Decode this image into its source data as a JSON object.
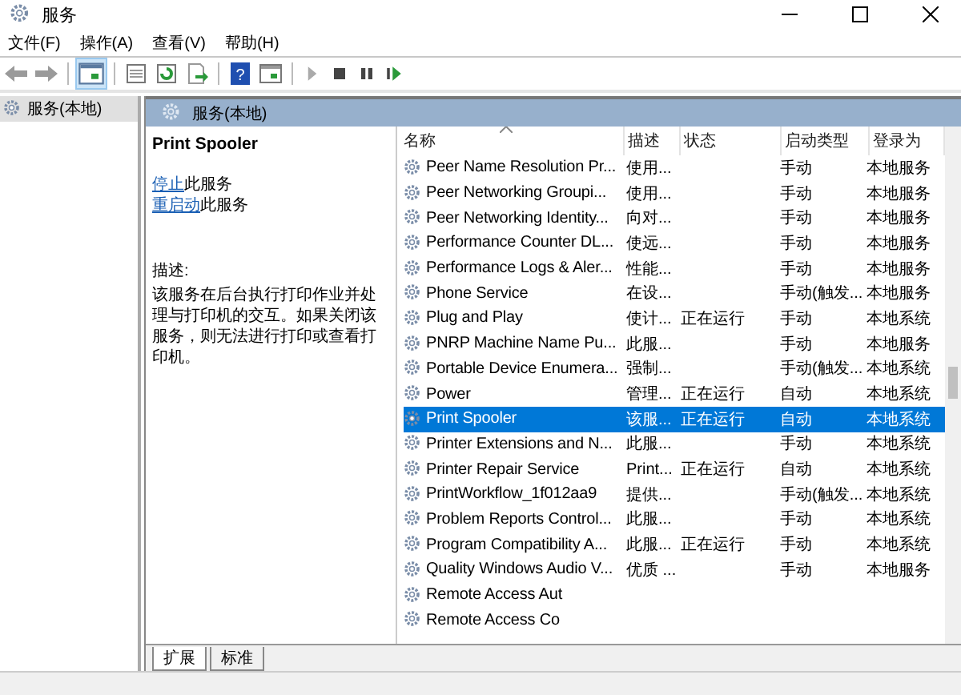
{
  "window": {
    "title": "服务"
  },
  "menu": [
    "文件(F)",
    "操作(A)",
    "查看(V)",
    "帮助(H)"
  ],
  "toolbar": {
    "help_glyph": "?"
  },
  "tree": [
    {
      "label": "服务(本地)",
      "selected": true
    }
  ],
  "header": {
    "title": "服务(本地)"
  },
  "details": {
    "name": "Print Spooler",
    "links": [
      {
        "link": "停止",
        "text": "此服务"
      },
      {
        "link": "重启动",
        "text": "此服务"
      }
    ],
    "desc_label": "描述:",
    "description": "该服务在后台执行打印作业并处理与打印机的交互。如果关闭该服务，则无法进行打印或查看打印机。"
  },
  "table": {
    "columns": [
      "名称",
      "描述",
      "状态",
      "启动类型",
      "登录为"
    ],
    "rows": [
      {
        "name": "Peer Name Resolution Pr...",
        "desc": "使用...",
        "status": "",
        "startup": "手动",
        "logon": "本地服务",
        "selected": false
      },
      {
        "name": "Peer Networking Groupi...",
        "desc": "使用...",
        "status": "",
        "startup": "手动",
        "logon": "本地服务",
        "selected": false
      },
      {
        "name": "Peer Networking Identity...",
        "desc": "向对...",
        "status": "",
        "startup": "手动",
        "logon": "本地服务",
        "selected": false
      },
      {
        "name": "Performance Counter DL...",
        "desc": "使远...",
        "status": "",
        "startup": "手动",
        "logon": "本地服务",
        "selected": false
      },
      {
        "name": "Performance Logs & Aler...",
        "desc": "性能...",
        "status": "",
        "startup": "手动",
        "logon": "本地服务",
        "selected": false
      },
      {
        "name": "Phone Service",
        "desc": "在设...",
        "status": "",
        "startup": "手动(触发...",
        "logon": "本地服务",
        "selected": false
      },
      {
        "name": "Plug and Play",
        "desc": "使计...",
        "status": "正在运行",
        "startup": "手动",
        "logon": "本地系统",
        "selected": false
      },
      {
        "name": "PNRP Machine Name Pu...",
        "desc": "此服...",
        "status": "",
        "startup": "手动",
        "logon": "本地服务",
        "selected": false
      },
      {
        "name": "Portable Device Enumera...",
        "desc": "强制...",
        "status": "",
        "startup": "手动(触发...",
        "logon": "本地系统",
        "selected": false
      },
      {
        "name": "Power",
        "desc": "管理...",
        "status": "正在运行",
        "startup": "自动",
        "logon": "本地系统",
        "selected": false
      },
      {
        "name": "Print Spooler",
        "desc": "该服...",
        "status": "正在运行",
        "startup": "自动",
        "logon": "本地系统",
        "selected": true
      },
      {
        "name": "Printer Extensions and N...",
        "desc": "此服...",
        "status": "",
        "startup": "手动",
        "logon": "本地系统",
        "selected": false
      },
      {
        "name": "Printer Repair Service",
        "desc": "Print...",
        "status": "正在运行",
        "startup": "自动",
        "logon": "本地系统",
        "selected": false
      },
      {
        "name": "PrintWorkflow_1f012aa9",
        "desc": "提供...",
        "status": "",
        "startup": "手动(触发...",
        "logon": "本地系统",
        "selected": false
      },
      {
        "name": "Problem Reports Control...",
        "desc": "此服...",
        "status": "",
        "startup": "手动",
        "logon": "本地系统",
        "selected": false
      },
      {
        "name": "Program Compatibility A...",
        "desc": "此服...",
        "status": "正在运行",
        "startup": "手动",
        "logon": "本地系统",
        "selected": false
      },
      {
        "name": "Quality Windows Audio V...",
        "desc": "优质 ...",
        "status": "",
        "startup": "手动",
        "logon": "本地服务",
        "selected": false
      },
      {
        "name": "Remote Access Aut",
        "desc": "",
        "status": "",
        "startup": "",
        "logon": "",
        "selected": false
      },
      {
        "name": "Remote Access Co",
        "desc": "",
        "status": "",
        "startup": "",
        "logon": "",
        "selected": false
      }
    ]
  },
  "bottom_tabs": [
    {
      "label": "扩展",
      "selected": true
    },
    {
      "label": "标准",
      "selected": false
    }
  ]
}
